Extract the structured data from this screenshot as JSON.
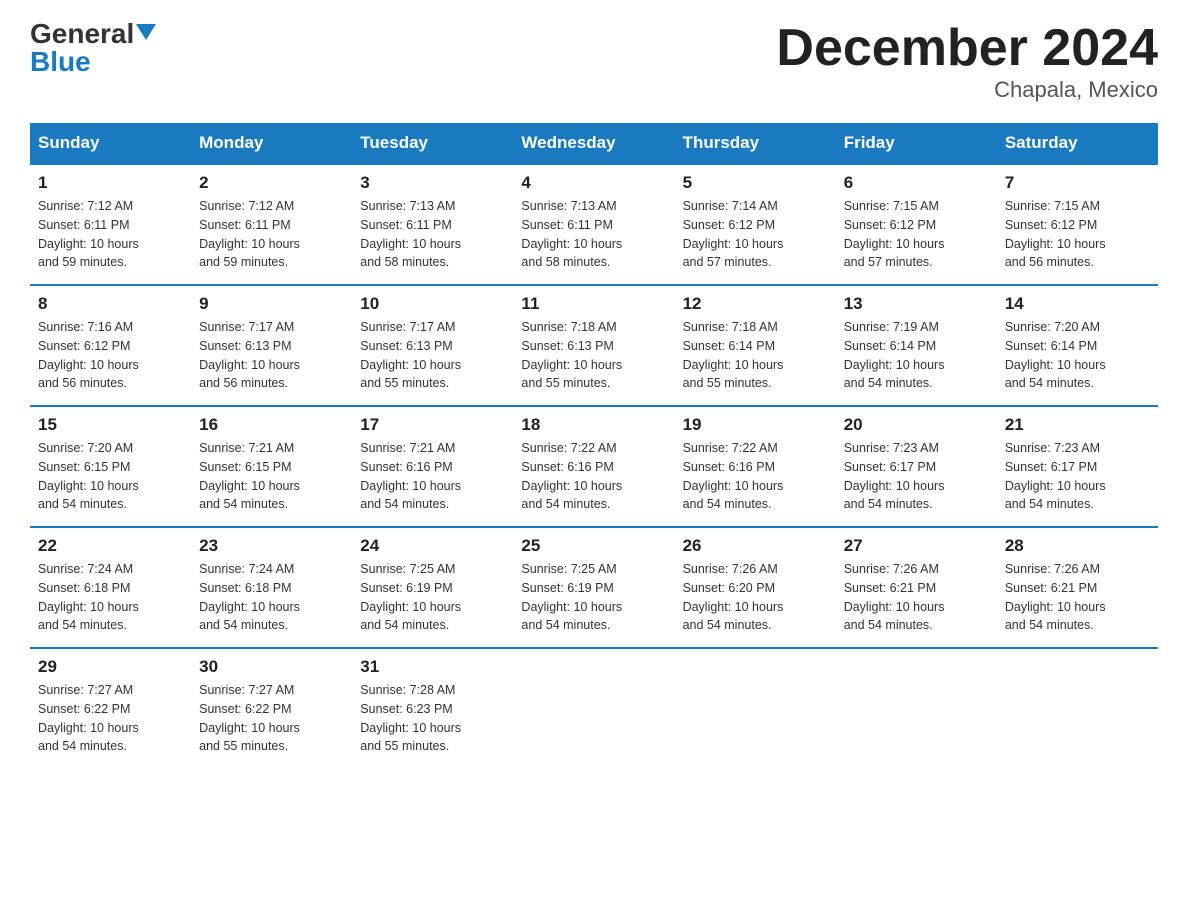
{
  "header": {
    "logo_general": "General",
    "logo_blue": "Blue",
    "month_title": "December 2024",
    "location": "Chapala, Mexico"
  },
  "days_of_week": [
    "Sunday",
    "Monday",
    "Tuesday",
    "Wednesday",
    "Thursday",
    "Friday",
    "Saturday"
  ],
  "weeks": [
    [
      {
        "day": "1",
        "sunrise": "7:12 AM",
        "sunset": "6:11 PM",
        "daylight": "10 hours and 59 minutes."
      },
      {
        "day": "2",
        "sunrise": "7:12 AM",
        "sunset": "6:11 PM",
        "daylight": "10 hours and 59 minutes."
      },
      {
        "day": "3",
        "sunrise": "7:13 AM",
        "sunset": "6:11 PM",
        "daylight": "10 hours and 58 minutes."
      },
      {
        "day": "4",
        "sunrise": "7:13 AM",
        "sunset": "6:11 PM",
        "daylight": "10 hours and 58 minutes."
      },
      {
        "day": "5",
        "sunrise": "7:14 AM",
        "sunset": "6:12 PM",
        "daylight": "10 hours and 57 minutes."
      },
      {
        "day": "6",
        "sunrise": "7:15 AM",
        "sunset": "6:12 PM",
        "daylight": "10 hours and 57 minutes."
      },
      {
        "day": "7",
        "sunrise": "7:15 AM",
        "sunset": "6:12 PM",
        "daylight": "10 hours and 56 minutes."
      }
    ],
    [
      {
        "day": "8",
        "sunrise": "7:16 AM",
        "sunset": "6:12 PM",
        "daylight": "10 hours and 56 minutes."
      },
      {
        "day": "9",
        "sunrise": "7:17 AM",
        "sunset": "6:13 PM",
        "daylight": "10 hours and 56 minutes."
      },
      {
        "day": "10",
        "sunrise": "7:17 AM",
        "sunset": "6:13 PM",
        "daylight": "10 hours and 55 minutes."
      },
      {
        "day": "11",
        "sunrise": "7:18 AM",
        "sunset": "6:13 PM",
        "daylight": "10 hours and 55 minutes."
      },
      {
        "day": "12",
        "sunrise": "7:18 AM",
        "sunset": "6:14 PM",
        "daylight": "10 hours and 55 minutes."
      },
      {
        "day": "13",
        "sunrise": "7:19 AM",
        "sunset": "6:14 PM",
        "daylight": "10 hours and 54 minutes."
      },
      {
        "day": "14",
        "sunrise": "7:20 AM",
        "sunset": "6:14 PM",
        "daylight": "10 hours and 54 minutes."
      }
    ],
    [
      {
        "day": "15",
        "sunrise": "7:20 AM",
        "sunset": "6:15 PM",
        "daylight": "10 hours and 54 minutes."
      },
      {
        "day": "16",
        "sunrise": "7:21 AM",
        "sunset": "6:15 PM",
        "daylight": "10 hours and 54 minutes."
      },
      {
        "day": "17",
        "sunrise": "7:21 AM",
        "sunset": "6:16 PM",
        "daylight": "10 hours and 54 minutes."
      },
      {
        "day": "18",
        "sunrise": "7:22 AM",
        "sunset": "6:16 PM",
        "daylight": "10 hours and 54 minutes."
      },
      {
        "day": "19",
        "sunrise": "7:22 AM",
        "sunset": "6:16 PM",
        "daylight": "10 hours and 54 minutes."
      },
      {
        "day": "20",
        "sunrise": "7:23 AM",
        "sunset": "6:17 PM",
        "daylight": "10 hours and 54 minutes."
      },
      {
        "day": "21",
        "sunrise": "7:23 AM",
        "sunset": "6:17 PM",
        "daylight": "10 hours and 54 minutes."
      }
    ],
    [
      {
        "day": "22",
        "sunrise": "7:24 AM",
        "sunset": "6:18 PM",
        "daylight": "10 hours and 54 minutes."
      },
      {
        "day": "23",
        "sunrise": "7:24 AM",
        "sunset": "6:18 PM",
        "daylight": "10 hours and 54 minutes."
      },
      {
        "day": "24",
        "sunrise": "7:25 AM",
        "sunset": "6:19 PM",
        "daylight": "10 hours and 54 minutes."
      },
      {
        "day": "25",
        "sunrise": "7:25 AM",
        "sunset": "6:19 PM",
        "daylight": "10 hours and 54 minutes."
      },
      {
        "day": "26",
        "sunrise": "7:26 AM",
        "sunset": "6:20 PM",
        "daylight": "10 hours and 54 minutes."
      },
      {
        "day": "27",
        "sunrise": "7:26 AM",
        "sunset": "6:21 PM",
        "daylight": "10 hours and 54 minutes."
      },
      {
        "day": "28",
        "sunrise": "7:26 AM",
        "sunset": "6:21 PM",
        "daylight": "10 hours and 54 minutes."
      }
    ],
    [
      {
        "day": "29",
        "sunrise": "7:27 AM",
        "sunset": "6:22 PM",
        "daylight": "10 hours and 54 minutes."
      },
      {
        "day": "30",
        "sunrise": "7:27 AM",
        "sunset": "6:22 PM",
        "daylight": "10 hours and 55 minutes."
      },
      {
        "day": "31",
        "sunrise": "7:28 AM",
        "sunset": "6:23 PM",
        "daylight": "10 hours and 55 minutes."
      },
      null,
      null,
      null,
      null
    ]
  ]
}
